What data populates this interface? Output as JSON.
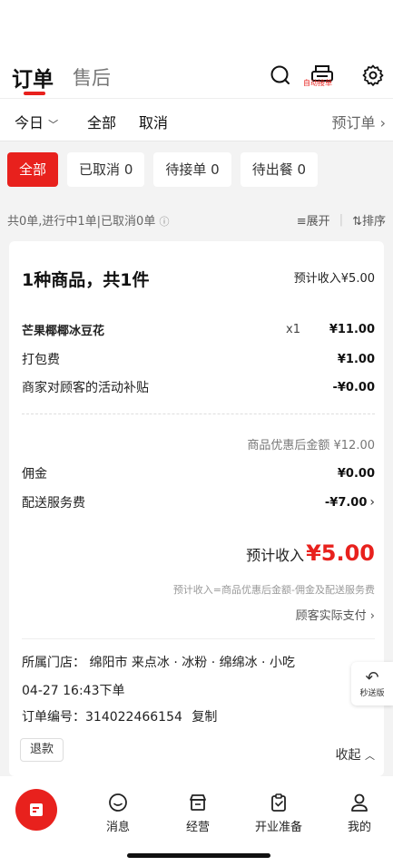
{
  "header": {
    "tab_orders": "订单",
    "tab_aftersale": "售后",
    "auto_accept": "自动接单"
  },
  "filters": {
    "date": "今日",
    "all": "全部",
    "cancel": "取消",
    "preorder": "预订单"
  },
  "chips": [
    {
      "label": "全部",
      "count": ""
    },
    {
      "label": "已取消",
      "count": "0"
    },
    {
      "label": "待接单",
      "count": "0"
    },
    {
      "label": "待出餐",
      "count": "0"
    }
  ],
  "summary": {
    "text": "共0单,进行中1单|已取消0单",
    "expand": "展开",
    "sort": "排序"
  },
  "order": {
    "title": "1种商品，共1件",
    "est_income_top": "预计收入¥5.00",
    "items": [
      {
        "name": "芒果椰椰冰豆花",
        "qty": "x1",
        "price": "¥11.00"
      },
      {
        "name": "打包费",
        "qty": "",
        "price": "¥1.00"
      },
      {
        "name": "商家对顾客的活动补贴",
        "qty": "",
        "price": "-¥0.00"
      }
    ],
    "subtotal": "商品优惠后金额 ¥12.00",
    "commission_label": "佣金",
    "commission": "¥0.00",
    "delivery_label": "配送服务费",
    "delivery": "-¥7.00",
    "income_label": "预计收入",
    "income": "¥5.00",
    "formula": "预计收入=商品优惠后金额-佣金及配送服务费",
    "customer_pay": "顾客实际支付",
    "store": "所属门店：  绵阳市 来点冰 · 冰粉 · 绵绵冰 · 小吃",
    "time": "04-27 16:43下单",
    "order_no_label": "订单编号：",
    "order_no": "314022466154",
    "copy": "复制",
    "refund": "退款",
    "collapse": "收起",
    "express": "秒送版"
  },
  "nav": {
    "messages": "消息",
    "business": "经营",
    "prepare": "开业准备",
    "mine": "我的"
  },
  "colors": {
    "accent": "#e8211d"
  }
}
